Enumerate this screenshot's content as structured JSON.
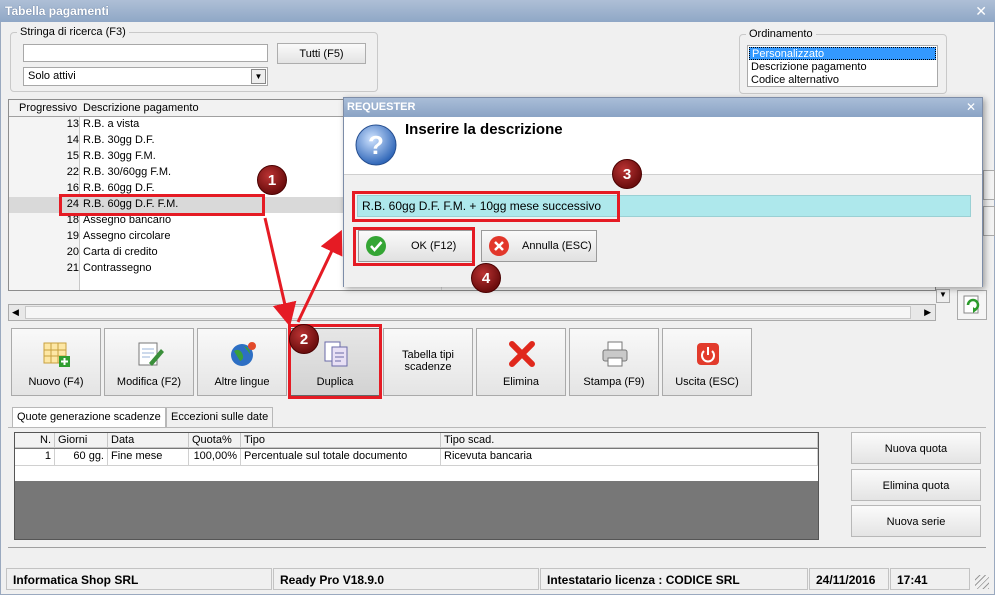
{
  "window": {
    "title": "Tabella pagamenti"
  },
  "search": {
    "legend": "Stringa di ricerca (F3)",
    "value": "",
    "all_button": "Tutti (F5)",
    "filter_selected": "Solo attivi"
  },
  "ordering": {
    "legend": "Ordinamento",
    "options": [
      "Personalizzato",
      "Descrizione pagamento",
      "Codice alternativo"
    ],
    "selected_index": 0
  },
  "grid": {
    "headers": [
      "Progressivo",
      "Descrizione pagamento"
    ],
    "rows": [
      {
        "n": "13",
        "desc": "R.B. a vista"
      },
      {
        "n": "14",
        "desc": "R.B. 30gg D.F."
      },
      {
        "n": "15",
        "desc": "R.B. 30gg F.M."
      },
      {
        "n": "22",
        "desc": "R.B. 30/60gg F.M."
      },
      {
        "n": "16",
        "desc": "R.B. 60gg D.F."
      },
      {
        "n": "24",
        "desc": "R.B. 60gg D.F. F.M."
      },
      {
        "n": "18",
        "desc": "Assegno bancario"
      },
      {
        "n": "19",
        "desc": "Assegno circolare"
      },
      {
        "n": "20",
        "desc": "Carta di credito"
      },
      {
        "n": "21",
        "desc": "Contrassegno"
      }
    ],
    "selected_index": 5
  },
  "toolbar": {
    "new": "Nuovo (F4)",
    "edit": "Modifica (F2)",
    "languages": "Altre lingue",
    "duplicate": "Duplica",
    "deadline_types": "Tabella tipi scadenze",
    "delete": "Elimina",
    "print": "Stampa (F9)",
    "exit": "Uscita (ESC)"
  },
  "tabs": [
    "Quote generazione scadenze",
    "Eccezioni sulle date"
  ],
  "quotes": {
    "headers": [
      "N.",
      "Giorni",
      "Data",
      "Quota%",
      "Tipo",
      "Tipo scad."
    ],
    "row": [
      "1",
      "60 gg.",
      "Fine mese",
      "100,00%",
      "Percentuale sul totale documento",
      "Ricevuta bancaria"
    ]
  },
  "side_buttons": {
    "new_quota": "Nuova quota",
    "delete_quota": "Elimina quota",
    "new_series": "Nuova serie"
  },
  "status": {
    "company": "Informatica Shop SRL",
    "version": "Ready Pro V18.9.0",
    "license": "Intestatario licenza : CODICE SRL",
    "date": "24/11/2016",
    "time": "17:41"
  },
  "dialog": {
    "title": "REQUESTER",
    "prompt": "Inserire la descrizione",
    "value": "R.B. 60gg D.F. F.M. + 10gg mese successivo",
    "ok": "OK (F12)",
    "cancel": "Annulla (ESC)"
  },
  "annotations": [
    "1",
    "2",
    "3",
    "4"
  ],
  "colors": {
    "accent_red": "#e51b24",
    "selection": "#3399ff",
    "input_highlight": "#aee8ec"
  }
}
